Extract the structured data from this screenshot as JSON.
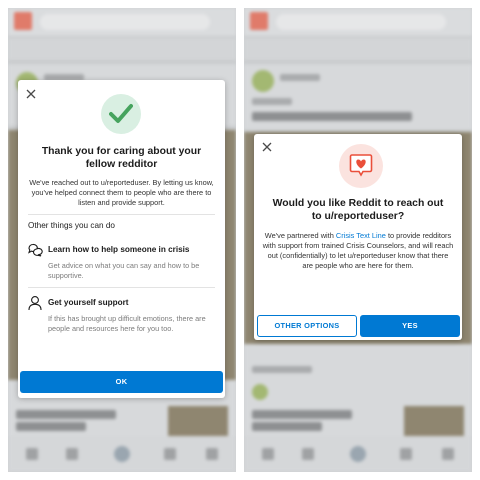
{
  "left_screen": {
    "background": {
      "post_title": "L.A. Times announces 2020 Book Prize nominees"
    },
    "modal": {
      "title": "Thank you for caring about your fellow redditor",
      "body": "We've reached out to u/reporteduser. By letting us know, you've helped connect them to people who are there to listen and provide support.",
      "section_label": "Other things you can do",
      "options": [
        {
          "icon": "help-chat-icon",
          "title": "Learn how to help someone in crisis",
          "description": "Get advice on what you can say and how to be supportive."
        },
        {
          "icon": "person-icon",
          "title": "Get yourself support",
          "description": "If this has brought up difficult emotions, there are people and resources here for you too."
        }
      ],
      "ok_label": "OK"
    }
  },
  "right_screen": {
    "background": {
      "post_title": "Waiting for departure. Me, Digital, 2020",
      "post_title_2": "L.A. Times announces 2020 Book Prize nominees"
    },
    "modal": {
      "title": "Would you like Reddit to reach out to u/reporteduser?",
      "body_before_link": "We've partnered with ",
      "link_text": "Crisis Text Line",
      "body_after_link": " to provide redditors with support from trained Crisis Counselors, and will reach out (confidentially) to let u/reporteduser know that there are people who are here for them.",
      "other_options_label": "OTHER OPTIONS",
      "yes_label": "YES"
    }
  },
  "colors": {
    "accent": "#0079d3",
    "success_green": "#46a35e",
    "heart_red": "#ea4f3a"
  }
}
